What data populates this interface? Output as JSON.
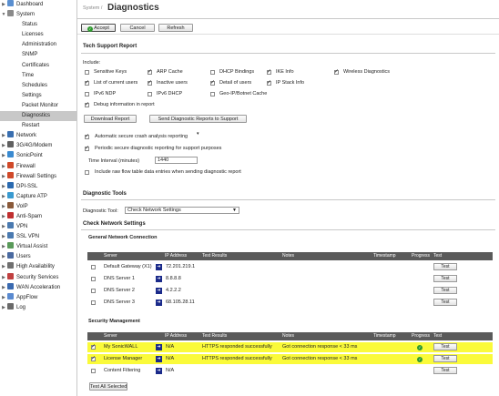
{
  "sidebar": {
    "items": [
      {
        "label": "Dashboard",
        "arrow": "▶",
        "color": "#5a8fd0",
        "sub": false
      },
      {
        "label": "System",
        "arrow": "▼",
        "color": "#8a8a8a",
        "sub": false
      },
      {
        "label": "Status",
        "sub": true
      },
      {
        "label": "Licenses",
        "sub": true
      },
      {
        "label": "Administration",
        "sub": true
      },
      {
        "label": "SNMP",
        "sub": true
      },
      {
        "label": "Certificates",
        "sub": true
      },
      {
        "label": "Time",
        "sub": true
      },
      {
        "label": "Schedules",
        "sub": true
      },
      {
        "label": "Settings",
        "sub": true
      },
      {
        "label": "Packet Monitor",
        "sub": true
      },
      {
        "label": "Diagnostics",
        "sub": true,
        "active": true
      },
      {
        "label": "Restart",
        "sub": true
      },
      {
        "label": "Network",
        "arrow": "▶",
        "color": "#3a6fb0",
        "sub": false
      },
      {
        "label": "3G/4G/Modem",
        "arrow": "▶",
        "color": "#606060",
        "sub": false
      },
      {
        "label": "SonicPoint",
        "arrow": "▶",
        "color": "#3a8ad0",
        "sub": false
      },
      {
        "label": "Firewall",
        "arrow": "▶",
        "color": "#d04a2a",
        "sub": false
      },
      {
        "label": "Firewall Settings",
        "arrow": "▶",
        "color": "#d04a2a",
        "sub": false
      },
      {
        "label": "DPI-SSL",
        "arrow": "▶",
        "color": "#2a6ab0",
        "sub": false
      },
      {
        "label": "Capture ATP",
        "arrow": "▶",
        "color": "#3a9ad0",
        "sub": false
      },
      {
        "label": "VoIP",
        "arrow": "▶",
        "color": "#8a5a3a",
        "sub": false
      },
      {
        "label": "Anti-Spam",
        "arrow": "▶",
        "color": "#c03030",
        "sub": false
      },
      {
        "label": "VPN",
        "arrow": "▶",
        "color": "#4a7ab0",
        "sub": false
      },
      {
        "label": "SSL VPN",
        "arrow": "▶",
        "color": "#4a7ab0",
        "sub": false
      },
      {
        "label": "Virtual Assist",
        "arrow": "▶",
        "color": "#5a9a5a",
        "sub": false
      },
      {
        "label": "Users",
        "arrow": "▶",
        "color": "#4a6aa0",
        "sub": false
      },
      {
        "label": "High Availability",
        "arrow": "▶",
        "color": "#707070",
        "sub": false
      },
      {
        "label": "Security Services",
        "arrow": "▶",
        "color": "#c04040",
        "sub": false
      },
      {
        "label": "WAN Acceleration",
        "arrow": "▶",
        "color": "#3a6ab0",
        "sub": false
      },
      {
        "label": "AppFlow",
        "arrow": "▶",
        "color": "#5a8ad0",
        "sub": false
      },
      {
        "label": "Log",
        "arrow": "▶",
        "color": "#6a6a6a",
        "sub": false
      }
    ]
  },
  "header": {
    "breadcrumb": "System /",
    "title": "Diagnostics"
  },
  "toolbar": {
    "accept": "Accept",
    "cancel": "Cancel",
    "refresh": "Refresh"
  },
  "tsr": {
    "title": "Tech Support Report",
    "include_label": "Include:",
    "options": [
      {
        "label": "Sensitive Keys",
        "on": false
      },
      {
        "label": "ARP Cache",
        "on": true
      },
      {
        "label": "DHCP Bindings",
        "on": false
      },
      {
        "label": "IKE Info",
        "on": true
      },
      {
        "label": "Wireless Diagnostics",
        "on": true
      },
      {
        "label": "List of current users",
        "on": true
      },
      {
        "label": "Inactive users",
        "on": true
      },
      {
        "label": "Detail of users",
        "on": true
      },
      {
        "label": "IP Stack Info",
        "on": true
      },
      {
        "label": "IPv6 NDP",
        "on": false
      },
      {
        "label": "IPv6 DHCP",
        "on": false
      },
      {
        "label": "Geo-IP/Botnet Cache",
        "on": false
      },
      {
        "label": "Debug information in report",
        "on": true
      }
    ],
    "download": "Download Report",
    "send": "Send Diagnostic Reports to Support",
    "auto_crash": "Automatic secure crash analysis reporting",
    "periodic": "Periodic secure diagnostic reporting for support purposes",
    "time_label": "Time Interval (minutes)",
    "time_value": "1440",
    "raw_flow": "Include raw flow table data entries when sending diagnostic report"
  },
  "tools": {
    "title": "Diagnostic Tools",
    "tool_label": "Diagnostic Tool:",
    "tool_value": "Check Network Settings",
    "check_title": "Check Network Settings"
  },
  "general": {
    "title": "General Network Connection",
    "headers": {
      "server": "Server",
      "ip": "IP Address",
      "results": "Test Results",
      "notes": "Notes",
      "timestamp": "Timestamp",
      "progress": "Progress",
      "test": "Test"
    },
    "rows": [
      {
        "server": "Default Gateway (X1)",
        "ip": "72.201.219.1",
        "results": "",
        "notes": "",
        "test": "Test",
        "checked": false
      },
      {
        "server": "DNS Server 1",
        "ip": "8.8.8.8",
        "results": "",
        "notes": "",
        "test": "Test",
        "checked": false
      },
      {
        "server": "DNS Server 2",
        "ip": "4.2.2.2",
        "results": "",
        "notes": "",
        "test": "Test",
        "checked": false
      },
      {
        "server": "DNS Server 3",
        "ip": "68.105.28.11",
        "results": "",
        "notes": "",
        "test": "Test",
        "checked": false
      }
    ]
  },
  "security": {
    "title": "Security Management",
    "rows": [
      {
        "server": "My SonicWALL",
        "ip": "N/A",
        "results": "HTTPS responded successfully",
        "notes": "Got connection response < 33 ms",
        "test": "Test",
        "checked": true,
        "ok": true
      },
      {
        "server": "License Manager",
        "ip": "N/A",
        "results": "HTTPS responded successfully",
        "notes": "Got connection response < 33 ms",
        "test": "Test",
        "checked": true,
        "ok": true
      },
      {
        "server": "Content Filtering",
        "ip": "N/A",
        "results": "",
        "notes": "",
        "test": "Test",
        "checked": false,
        "ok": false
      }
    ],
    "test_all": "Test All Selected"
  }
}
